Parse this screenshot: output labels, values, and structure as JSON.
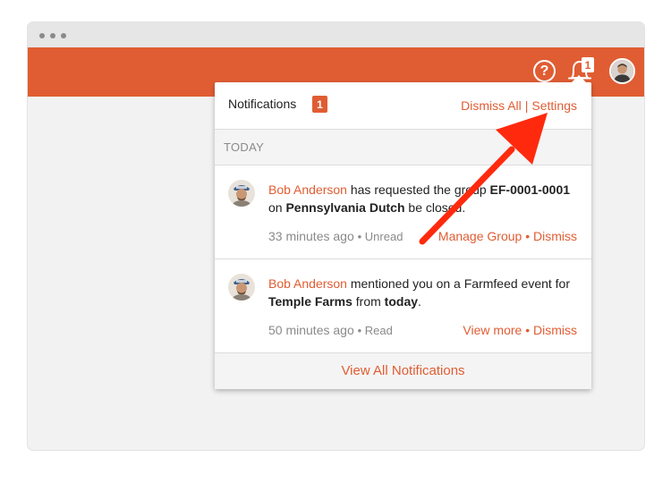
{
  "appbar": {
    "bell_badge": "1",
    "icons": [
      "help-icon",
      "bell-icon",
      "user-avatar"
    ]
  },
  "panel": {
    "title": "Notifications",
    "count": "1",
    "dismiss_all": "Dismiss All",
    "separator": "|",
    "settings": "Settings",
    "section": "TODAY",
    "footer": "View All Notifications"
  },
  "notifications": [
    {
      "name": "Bob Anderson",
      "text1": " has requested the group ",
      "bold1": "EF-0001-0001",
      "text2": " on ",
      "bold2": "Pennsylvania Dutch",
      "text3": " be closed.",
      "time": "33 minutes ago",
      "status": "• Unread",
      "action": "Manage Group",
      "bullet": "•",
      "dismiss": "Dismiss"
    },
    {
      "name": "Bob Anderson",
      "text1": " mentioned you on a Farmfeed event for ",
      "bold1": "Temple Farms",
      "text2": " from ",
      "bold2": "today",
      "text3": ".",
      "time": "50 minutes ago",
      "status": "• Read",
      "action": "View more",
      "bullet": "•",
      "dismiss": "Dismiss"
    }
  ],
  "colors": {
    "accent": "#e05d33",
    "arrow": "#ff2a0e",
    "background": "#f2f2f2"
  }
}
